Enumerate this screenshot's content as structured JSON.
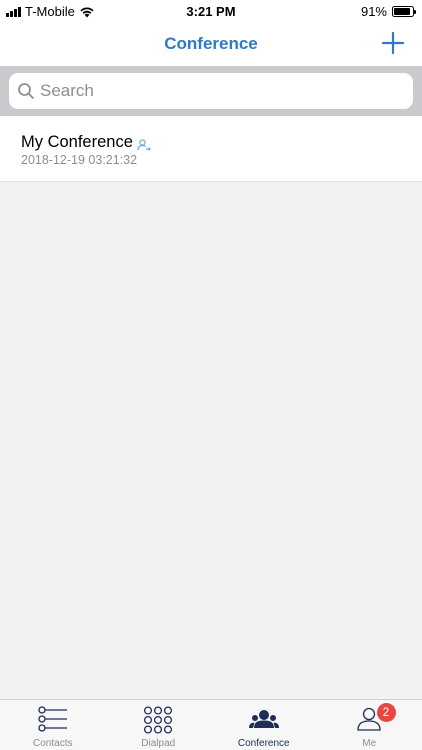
{
  "status_bar": {
    "carrier": "T-Mobile",
    "time": "3:21 PM",
    "battery_percent_label": "91%",
    "battery_level": 0.91
  },
  "nav": {
    "title": "Conference",
    "add_icon": "plus-icon"
  },
  "search": {
    "placeholder": "Search",
    "value": "",
    "icon": "search-icon"
  },
  "conferences": [
    {
      "title": "My Conference",
      "date": "2018-12-19 03:21:32",
      "icon": "user-transfer-icon"
    }
  ],
  "tabs": [
    {
      "label": "Contacts",
      "icon": "contacts-list-icon",
      "active": false
    },
    {
      "label": "Dialpad",
      "icon": "dialpad-icon",
      "active": false
    },
    {
      "label": "Conference",
      "icon": "conference-icon",
      "active": true
    },
    {
      "label": "Me",
      "icon": "person-icon",
      "active": false,
      "badge": "2"
    }
  ],
  "colors": {
    "accent": "#2f79c9",
    "active_tab": "#1f2d57",
    "badge": "#e8463f"
  }
}
